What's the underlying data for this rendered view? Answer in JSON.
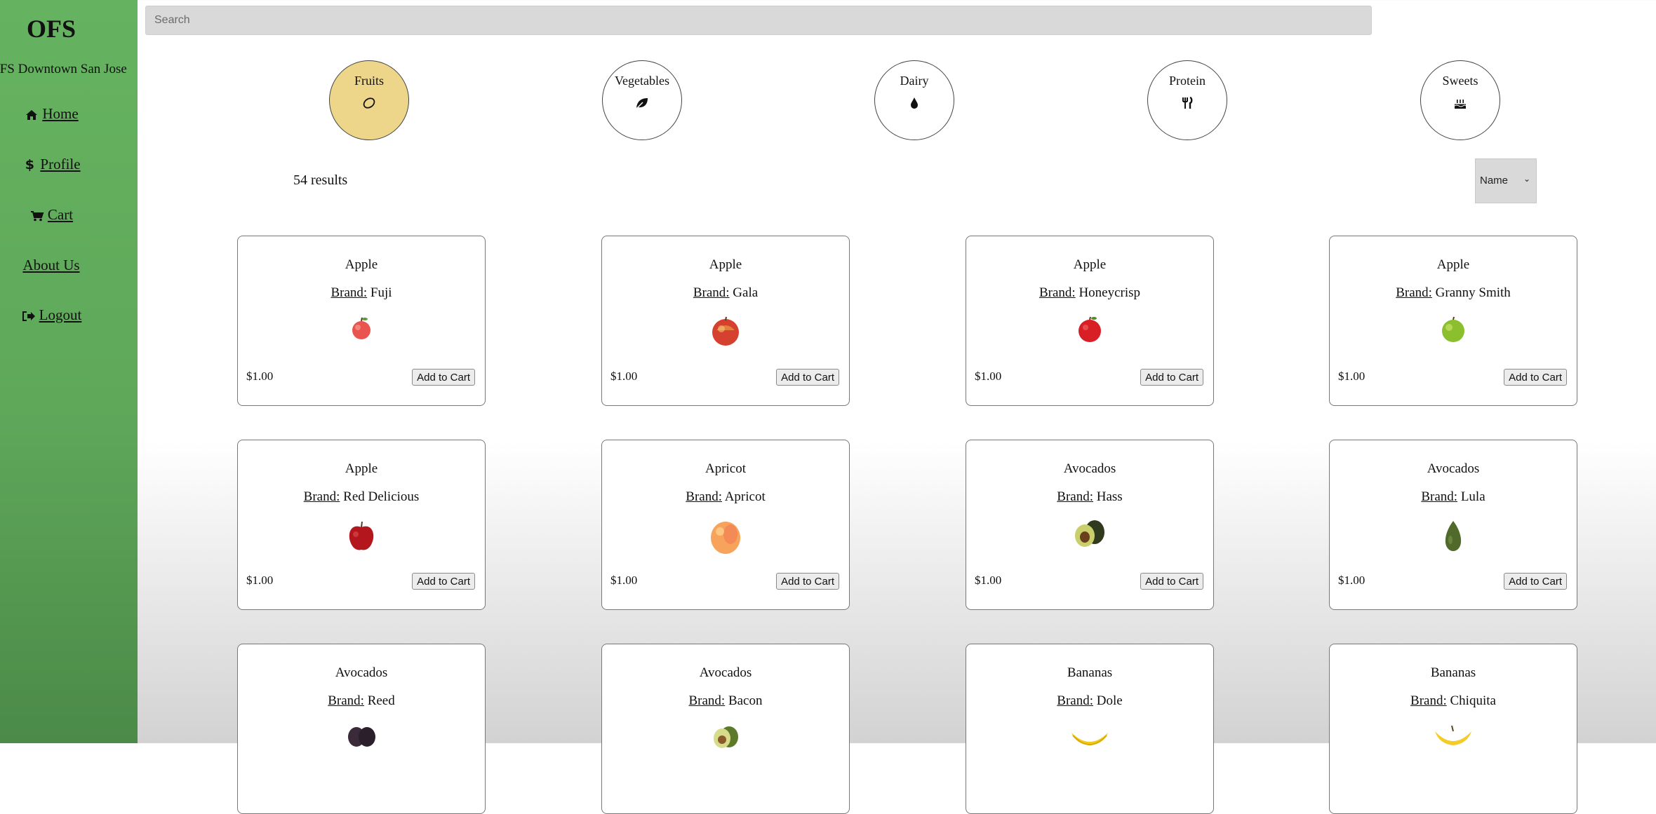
{
  "sidebar": {
    "title": "OFS",
    "subtitle": "OFS Downtown San Jose",
    "nav": [
      {
        "label": "Home",
        "icon": "home-icon"
      },
      {
        "label": "Profile",
        "icon": "dollar-icon"
      },
      {
        "label": "Cart",
        "icon": "cart-icon"
      },
      {
        "label": "About Us",
        "icon": ""
      },
      {
        "label": "Logout",
        "icon": "logout-icon"
      }
    ]
  },
  "search": {
    "placeholder": "Search",
    "value": ""
  },
  "categories": [
    {
      "label": "Fruits",
      "icon": "lemon-icon",
      "active": true
    },
    {
      "label": "Vegetables",
      "icon": "leaf-icon",
      "active": false
    },
    {
      "label": "Dairy",
      "icon": "droplet-icon",
      "active": false
    },
    {
      "label": "Protein",
      "icon": "utensils-icon",
      "active": false
    },
    {
      "label": "Sweets",
      "icon": "cake-icon",
      "active": false
    }
  ],
  "results": {
    "count_text": "54 results"
  },
  "sort": {
    "selected": "Name"
  },
  "products": [
    {
      "name": "Apple",
      "brand_label": "Brand:",
      "brand": "Fuji",
      "price": "$1.00",
      "button": "Add to Cart",
      "image": "apple-fuji"
    },
    {
      "name": "Apple",
      "brand_label": "Brand:",
      "brand": "Gala",
      "price": "$1.00",
      "button": "Add to Cart",
      "image": "apple-gala"
    },
    {
      "name": "Apple",
      "brand_label": "Brand:",
      "brand": "Honeycrisp",
      "price": "$1.00",
      "button": "Add to Cart",
      "image": "apple-honeycrisp"
    },
    {
      "name": "Apple",
      "brand_label": "Brand:",
      "brand": "Granny Smith",
      "price": "$1.00",
      "button": "Add to Cart",
      "image": "apple-granny-smith"
    },
    {
      "name": "Apple",
      "brand_label": "Brand:",
      "brand": "Red Delicious",
      "price": "$1.00",
      "button": "Add to Cart",
      "image": "apple-red-delicious"
    },
    {
      "name": "Apricot",
      "brand_label": "Brand:",
      "brand": "Apricot",
      "price": "$1.00",
      "button": "Add to Cart",
      "image": "apricot"
    },
    {
      "name": "Avocados",
      "brand_label": "Brand:",
      "brand": "Hass",
      "price": "$1.00",
      "button": "Add to Cart",
      "image": "avocado-hass"
    },
    {
      "name": "Avocados",
      "brand_label": "Brand:",
      "brand": "Lula",
      "price": "$1.00",
      "button": "Add to Cart",
      "image": "avocado-lula"
    },
    {
      "name": "Avocados",
      "brand_label": "Brand:",
      "brand": "Reed",
      "price": "",
      "button": "",
      "image": "avocado-reed"
    },
    {
      "name": "Avocados",
      "brand_label": "Brand:",
      "brand": "Bacon",
      "price": "",
      "button": "",
      "image": "avocado-bacon"
    },
    {
      "name": "Bananas",
      "brand_label": "Brand:",
      "brand": "Dole",
      "price": "",
      "button": "",
      "image": "banana-dole"
    },
    {
      "name": "Bananas",
      "brand_label": "Brand:",
      "brand": "Chiquita",
      "price": "",
      "button": "",
      "image": "banana-chiquita"
    }
  ],
  "colors": {
    "sidebar_green": "#65b360",
    "active_category": "#edd58a",
    "search_bg": "#d9d9d9"
  }
}
